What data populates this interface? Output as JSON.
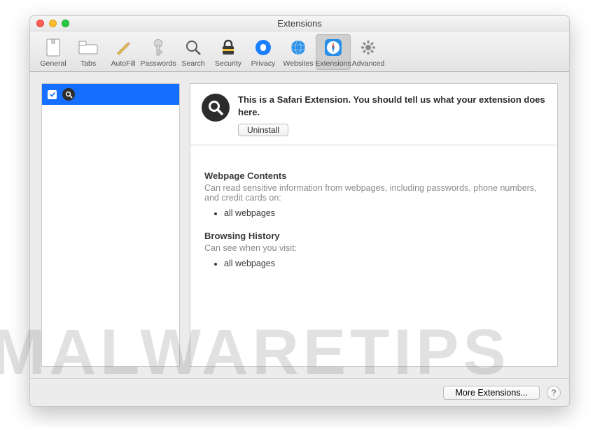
{
  "window": {
    "title": "Extensions"
  },
  "toolbar": {
    "items": [
      {
        "label": "General"
      },
      {
        "label": "Tabs"
      },
      {
        "label": "AutoFill"
      },
      {
        "label": "Passwords"
      },
      {
        "label": "Search"
      },
      {
        "label": "Security"
      },
      {
        "label": "Privacy"
      },
      {
        "label": "Websites"
      },
      {
        "label": "Extensions"
      },
      {
        "label": "Advanced"
      }
    ]
  },
  "sidebar": {
    "items": [
      {
        "checked": true,
        "icon": "search-icon",
        "name": ""
      }
    ]
  },
  "detail": {
    "description": "This is a Safari Extension. You should tell us what your extension does here.",
    "uninstall_label": "Uninstall",
    "sections": [
      {
        "title": "Webpage Contents",
        "subtitle": "Can read sensitive information from webpages, including passwords, phone numbers, and credit cards on:",
        "items": [
          "all webpages"
        ]
      },
      {
        "title": "Browsing History",
        "subtitle": "Can see when you visit:",
        "items": [
          "all webpages"
        ]
      }
    ]
  },
  "footer": {
    "more_label": "More Extensions...",
    "help_label": "?"
  },
  "watermark": "MALWARETIPS"
}
